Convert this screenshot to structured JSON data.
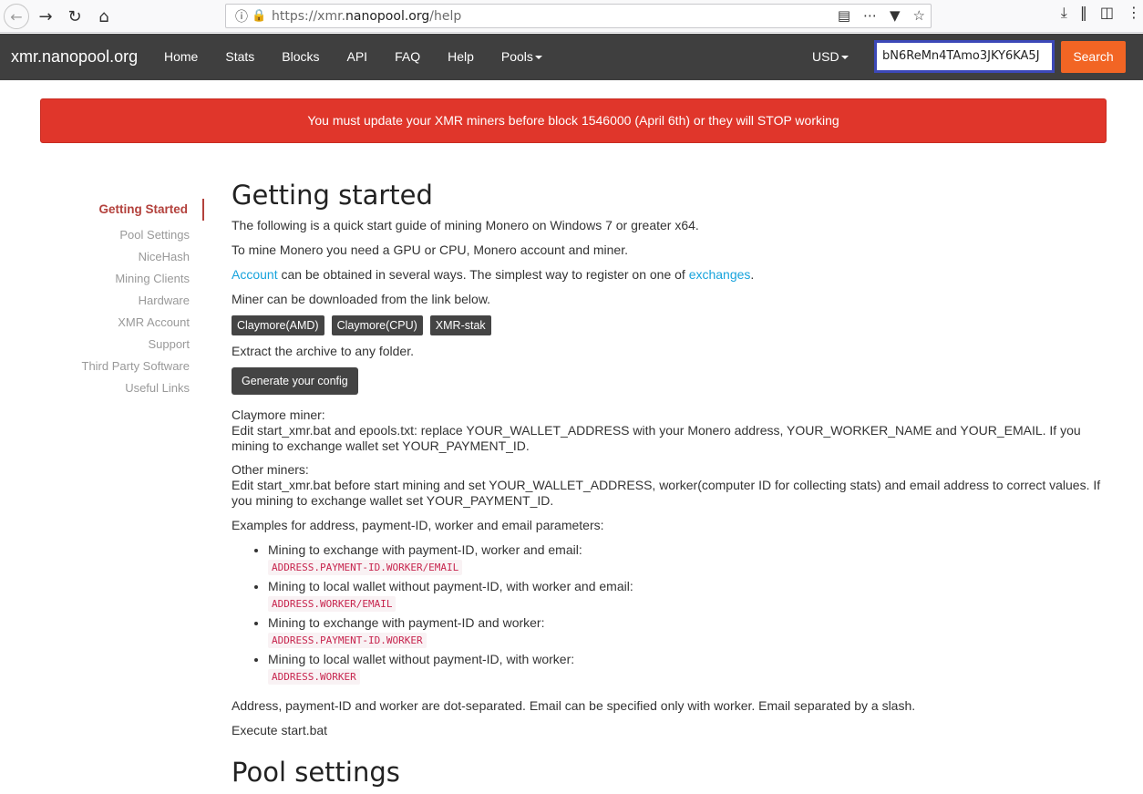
{
  "browser": {
    "url_prefix": "https://xmr.",
    "url_domain": "nanopool.org",
    "url_path": "/help"
  },
  "navbar": {
    "brand": "xmr.nanopool.org",
    "links": [
      "Home",
      "Stats",
      "Blocks",
      "API",
      "FAQ",
      "Help",
      "Pools"
    ],
    "currency": "USD",
    "search_value": "bN6ReMn4TAmo3JKY6KA5J",
    "search_button": "Search"
  },
  "alert": {
    "text": "You must update your XMR miners before block 1546000 (April 6th) or they will STOP working"
  },
  "sidebar": {
    "items": [
      "Getting Started",
      "Pool Settings",
      "NiceHash",
      "Mining Clients",
      "Hardware",
      "XMR Account",
      "Support",
      "Third Party Software",
      "Useful Links"
    ]
  },
  "main": {
    "title": "Getting started",
    "intro": "The following is a quick start guide of mining Monero on Windows 7 or greater x64.",
    "need": "To mine Monero you need a GPU or CPU, Monero account and miner.",
    "account_link": "Account",
    "account_text": " can be obtained in several ways. The simplest way to register on one of ",
    "exchanges_link": "exchanges",
    "account_end": ".",
    "download_text": "Miner can be downloaded from the link below.",
    "downloads": [
      "Claymore(AMD)",
      "Claymore(CPU)",
      "XMR-stak"
    ],
    "extract_text": "Extract the archive to any folder.",
    "generate_button": "Generate your config",
    "claymore_heading": "Claymore miner:",
    "claymore_text": "Edit start_xmr.bat and epools.txt: replace YOUR_WALLET_ADDRESS with your Monero address, YOUR_WORKER_NAME and YOUR_EMAIL. If you mining to exchange wallet set YOUR_PAYMENT_ID.",
    "other_heading": "Other miners:",
    "other_text": "Edit start_xmr.bat before start mining and set YOUR_WALLET_ADDRESS, worker(computer ID for collecting stats) and email address to correct values. If you mining to exchange wallet set YOUR_PAYMENT_ID.",
    "examples_intro": "Examples for address, payment-ID, worker and email parameters:",
    "examples": [
      {
        "label": "Mining to exchange with payment-ID, worker and email:",
        "code": "ADDRESS.PAYMENT-ID.WORKER/EMAIL"
      },
      {
        "label": "Mining to local wallet without payment-ID, with worker and email:",
        "code": "ADDRESS.WORKER/EMAIL"
      },
      {
        "label": "Mining to exchange with payment-ID and worker:",
        "code": "ADDRESS.PAYMENT-ID.WORKER"
      },
      {
        "label": "Mining to local wallet without payment-ID, with worker:",
        "code": "ADDRESS.WORKER"
      }
    ],
    "separator_note": "Address, payment-ID and worker are dot-separated. Email can be specified only with worker. Email separated by a slash.",
    "execute": "Execute start.bat",
    "section2_title": "Pool settings"
  }
}
